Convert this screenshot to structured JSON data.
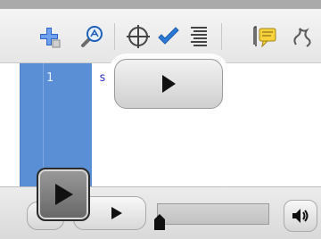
{
  "editor": {
    "line_numbers": [
      "1"
    ],
    "code_lines": [
      "s"
    ]
  },
  "toolbar": {
    "icons": [
      "add-icon",
      "zoom-icon",
      "crosshair-icon",
      "check-icon",
      "align-text-icon",
      "comment-icon",
      "script-icon"
    ]
  },
  "player": {
    "seek_progress": 0.0,
    "icons": [
      "play-icon",
      "volume-icon"
    ]
  },
  "colors": {
    "gutter": "#5a8fd6",
    "code_text": "#3333cc",
    "check_blue": "#2a7ad6",
    "add_blue": "#2c66c9"
  }
}
